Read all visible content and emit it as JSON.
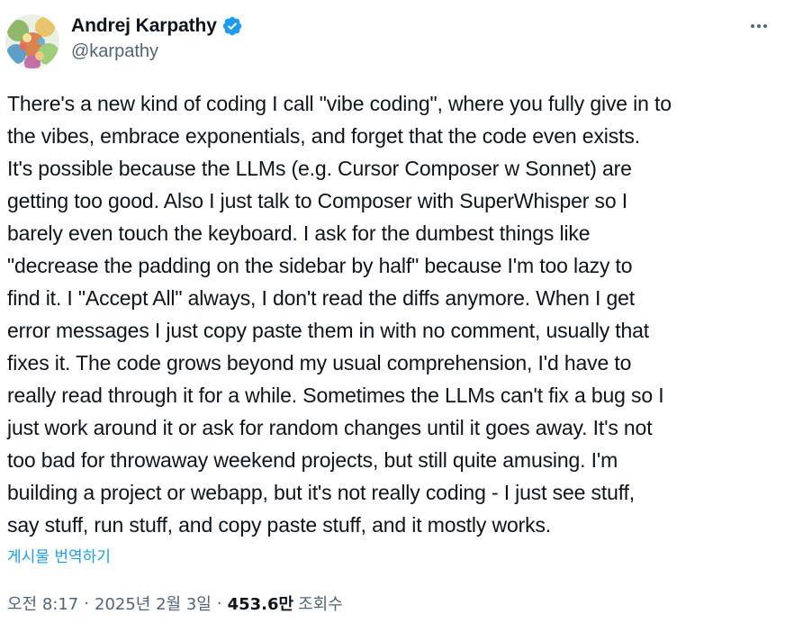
{
  "author": {
    "display_name": "Andrej Karpathy",
    "handle": "@karpathy",
    "verified": true,
    "avatar_icon": "avatar-artwork"
  },
  "more_icon": "more-horizontal-icon",
  "tweet": {
    "text": "There's a new kind of coding I call \"vibe coding\", where you fully give in to\nthe vibes, embrace exponentials, and forget that the code even exists.\nIt's possible because the LLMs (e.g. Cursor Composer w Sonnet) are\ngetting too good. Also I just talk to Composer with SuperWhisper so I\nbarely even touch the keyboard. I ask for the dumbest things like\n\"decrease the padding on the sidebar by half\" because I'm too lazy to\nfind it. I \"Accept All\" always, I don't read the diffs anymore. When I get\nerror messages I just copy paste them in with no comment, usually that\nfixes it. The code grows beyond my usual comprehension, I'd have to\nreally read through it for a while. Sometimes the LLMs can't fix a bug so I\njust work around it or ask for random changes until it goes away. It's not\ntoo bad for throwaway weekend projects, but still quite amusing. I'm\nbuilding a project or webapp, but it's not really coding - I just see stuff,\nsay stuff, run stuff, and copy paste stuff, and it mostly works.",
    "translate_label": "게시물 번역하기"
  },
  "meta": {
    "time": "오전 8:17",
    "separator": "·",
    "date": "2025년 2월 3일",
    "views_count": "453.6만",
    "views_label": "조회수"
  },
  "colors": {
    "text": "#0f1419",
    "secondary": "#536471",
    "link": "#1d9bf0",
    "verified_badge": "#1d9bf0"
  }
}
